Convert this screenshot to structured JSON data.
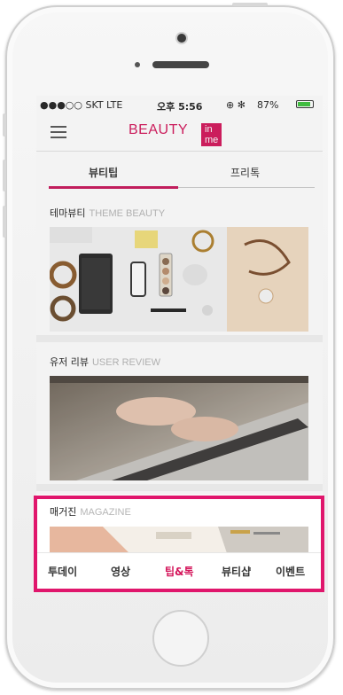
{
  "status_bar": {
    "carrier": "●●●○○ SKT",
    "network": "LTE",
    "time": "오후 5:56",
    "icons": "⊕ ✻",
    "battery_percent": "87%",
    "battery_level": 0.87
  },
  "header": {
    "logo_text": "BEAUTY",
    "logo_badge": "in me",
    "menu_icon": "hamburger-icon"
  },
  "tabs": [
    {
      "label": "뷰티팁",
      "active": true
    },
    {
      "label": "프리톡",
      "active": false
    }
  ],
  "sections": [
    {
      "title_ko": "테마뷰티",
      "title_en": "THEME BEAUTY"
    },
    {
      "title_ko": "유저 리뷰",
      "title_en": "USER REVIEW"
    },
    {
      "title_ko": "매거진",
      "title_en": "MAGAZINE"
    }
  ],
  "bottom_nav": [
    {
      "label": "투데이",
      "active": false
    },
    {
      "label": "영상",
      "active": false
    },
    {
      "label": "팁&톡",
      "active": true
    },
    {
      "label": "뷰티샵",
      "active": false
    },
    {
      "label": "이벤트",
      "active": false
    }
  ],
  "colors": {
    "accent": "#d4145a",
    "highlight_border": "#e0166c"
  }
}
